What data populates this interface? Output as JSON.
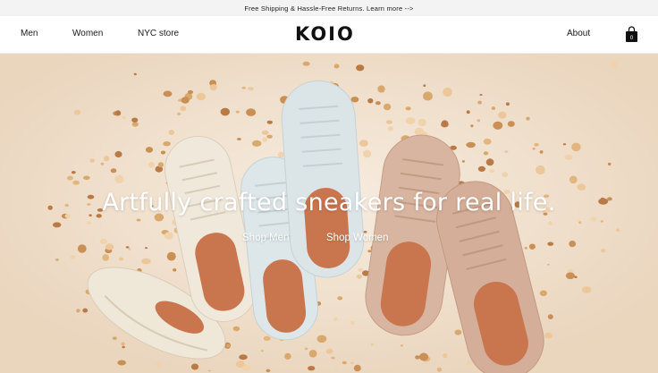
{
  "announcement": {
    "text": "Free Shipping & Hassle-Free Returns. Learn more -->"
  },
  "nav": {
    "left_links": [
      "Men",
      "Women",
      "NYC store"
    ],
    "logo": "KOIO",
    "about": "About",
    "cart_count": "0"
  },
  "hero": {
    "headline": "Artfully crafted sneakers for real life.",
    "cta_men": "Shop Men",
    "cta_women": "Shop Women"
  },
  "icons": {
    "cart": "shopping-bag-icon"
  },
  "colors": {
    "hero_background": "#efdcc6",
    "shoe_cream": "#ece3d3",
    "shoe_light_blue": "#d9e3e7",
    "shoe_blush": "#d6b29d",
    "shoe_lining": "#c9764e",
    "pebbles": "#d9a86c"
  }
}
